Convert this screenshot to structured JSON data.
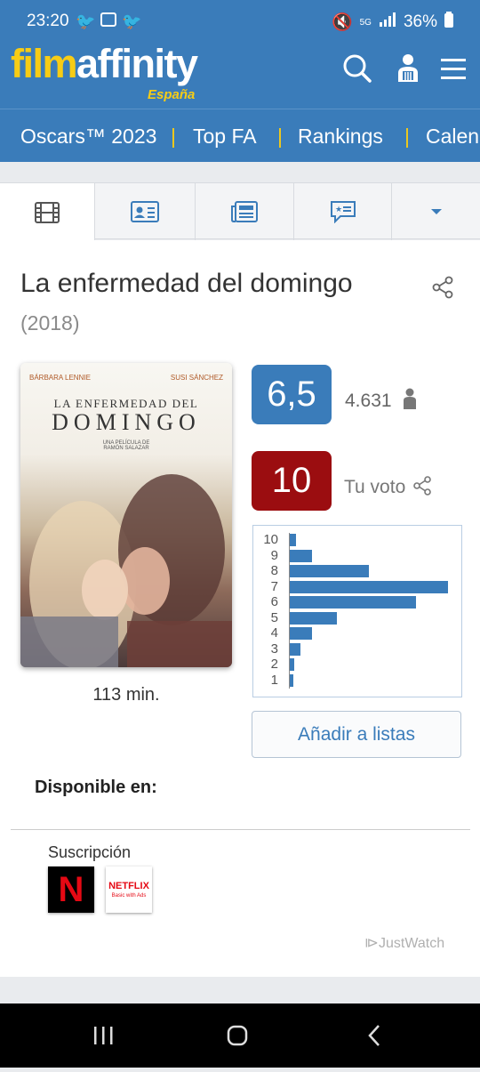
{
  "status_bar": {
    "time": "23:20",
    "network": "5G",
    "battery": "36%"
  },
  "header": {
    "logo_main": "film",
    "logo_accent": "affinity",
    "logo_sub": "España"
  },
  "nav": {
    "items": [
      "Oscars™ 2023",
      "Top FA",
      "Rankings",
      "Calen"
    ],
    "separator": "|"
  },
  "tabs": [
    "film-icon",
    "id-card-icon",
    "news-icon",
    "reviews-icon",
    "dropdown-icon"
  ],
  "movie": {
    "title": "La enfermedad del domingo",
    "year": "(2018)",
    "duration": "113 min.",
    "poster": {
      "actor_left": "BÁRBARA LENNIE",
      "actor_right": "SUSI SÁNCHEZ",
      "title_line1": "LA ENFERMEDAD DEL",
      "title_line2": "DOMINGO",
      "director_credit": "UNA PELÍCULA DE\nRAMÓN SALAZAR"
    }
  },
  "rating": {
    "score": "6,5",
    "votes": "4.631",
    "my_vote": "10",
    "my_vote_label": "Tu voto"
  },
  "histogram": {
    "labels": [
      "10",
      "9",
      "8",
      "7",
      "6",
      "5",
      "4",
      "3",
      "2",
      "1"
    ],
    "values": [
      0.04,
      0.14,
      0.5,
      1.0,
      0.8,
      0.3,
      0.14,
      0.07,
      0.03,
      0.02
    ]
  },
  "add_list_label": "Añadir a listas",
  "availability": {
    "heading": "Disponible en:",
    "category": "Suscripción",
    "provider1": "N",
    "provider2_name": "NETFLIX",
    "provider2_sub": "Basic with Ads",
    "attribution": "JustWatch"
  },
  "colors": {
    "brand_blue": "#3a7cba",
    "brand_yellow": "#f7cc15",
    "vote_red": "#9b0d10"
  }
}
